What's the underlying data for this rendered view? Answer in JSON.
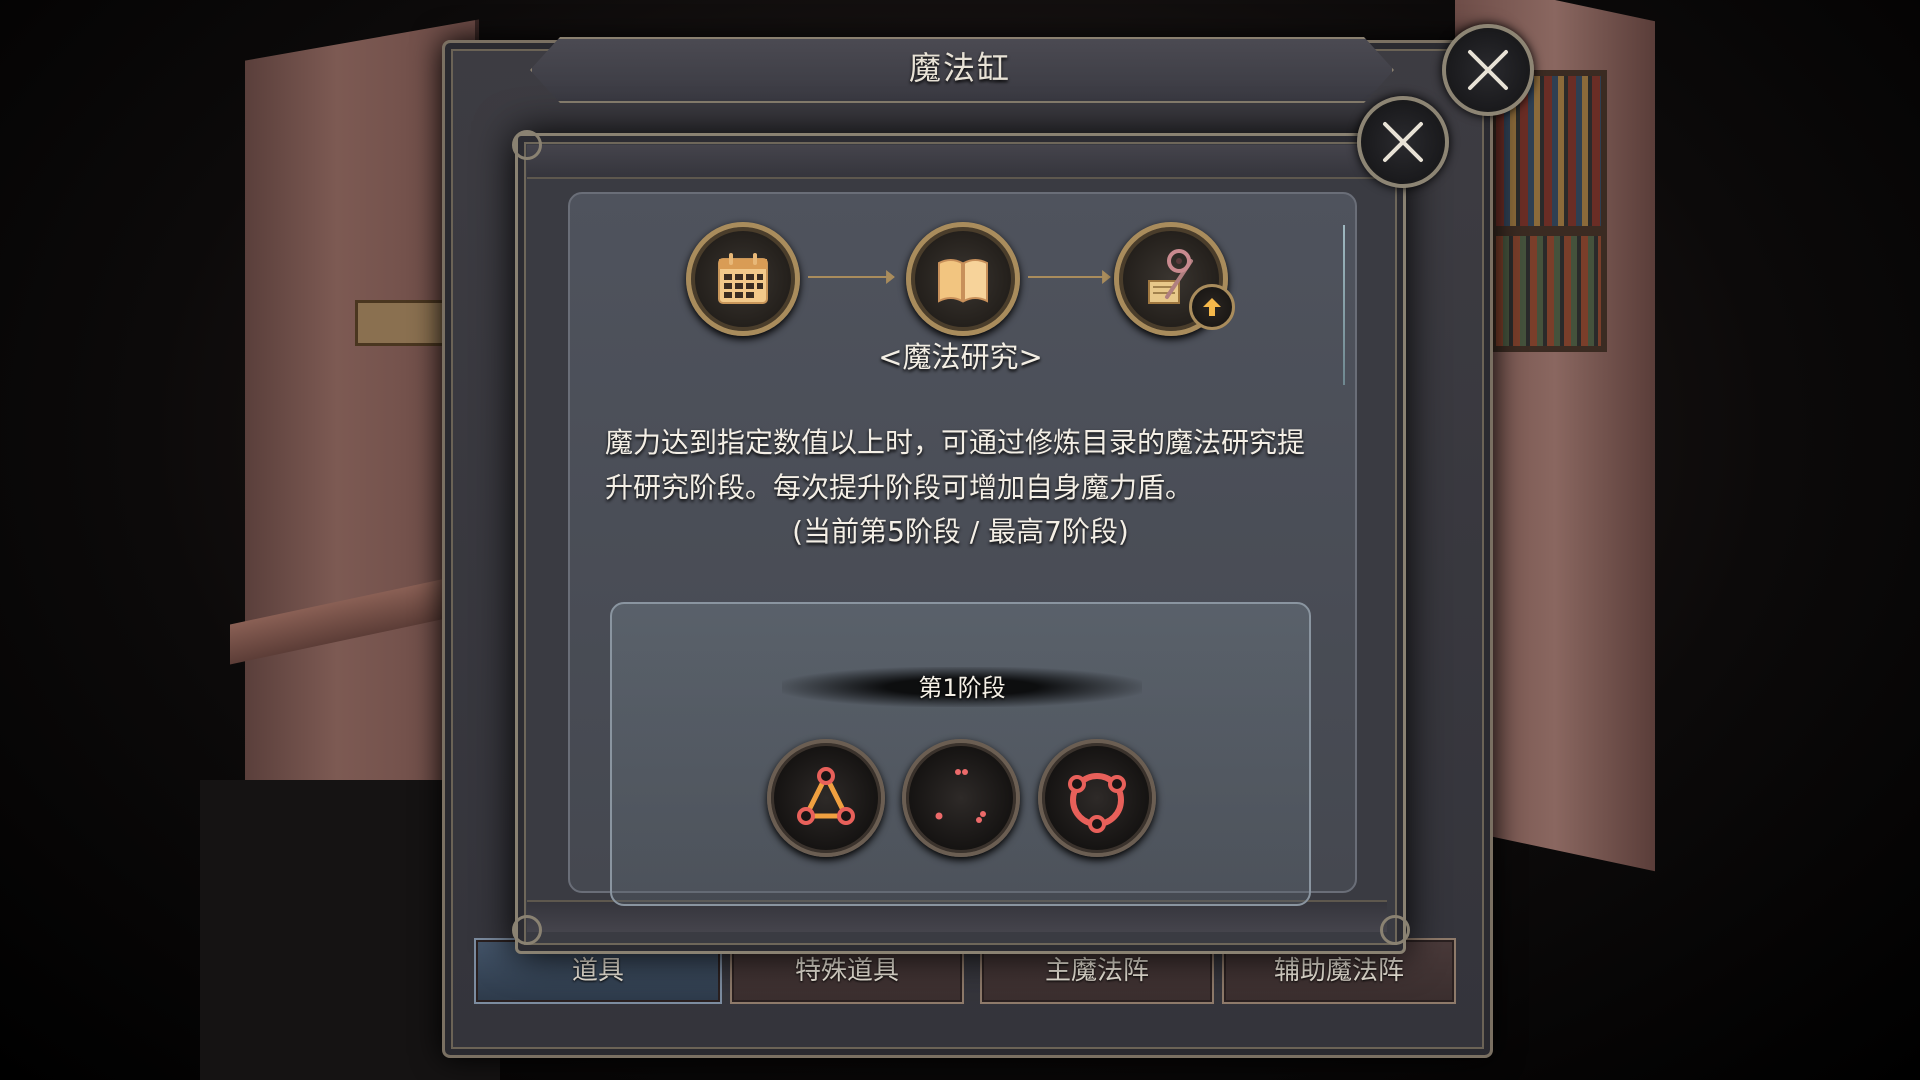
{
  "outer_window": {
    "title": "魔法缸"
  },
  "tabs": [
    {
      "label": "道具",
      "active": true
    },
    {
      "label": "特殊道具",
      "active": false
    },
    {
      "label": "主魔法阵",
      "active": false
    },
    {
      "label": "辅助魔法阵",
      "active": false
    }
  ],
  "modal": {
    "steps": [
      {
        "icon": "calendar-icon"
      },
      {
        "icon": "open-book-icon"
      },
      {
        "icon": "staff-upgrade-icon"
      }
    ],
    "section_title": "<魔法研究>",
    "description": "魔力达到指定数值以上时，可通过修炼目录的魔法研究提升研究阶段。每次提升阶段可增加自身魔力盾。",
    "stage_note": "(当前第5阶段 / 最高7阶段)",
    "stage_box": {
      "label": "第1阶段",
      "circles": [
        {
          "icon": "triangle-circle-icon"
        },
        {
          "icon": "three-dots-circle-icon"
        },
        {
          "icon": "ring-circle-icon"
        }
      ]
    }
  },
  "colors": {
    "accent_gold": "#a98c5c",
    "panel_bg": "#3a3b42",
    "active_tab": "#44556a",
    "magic_red": "#e8605a",
    "magic_orange": "#f0a040"
  }
}
